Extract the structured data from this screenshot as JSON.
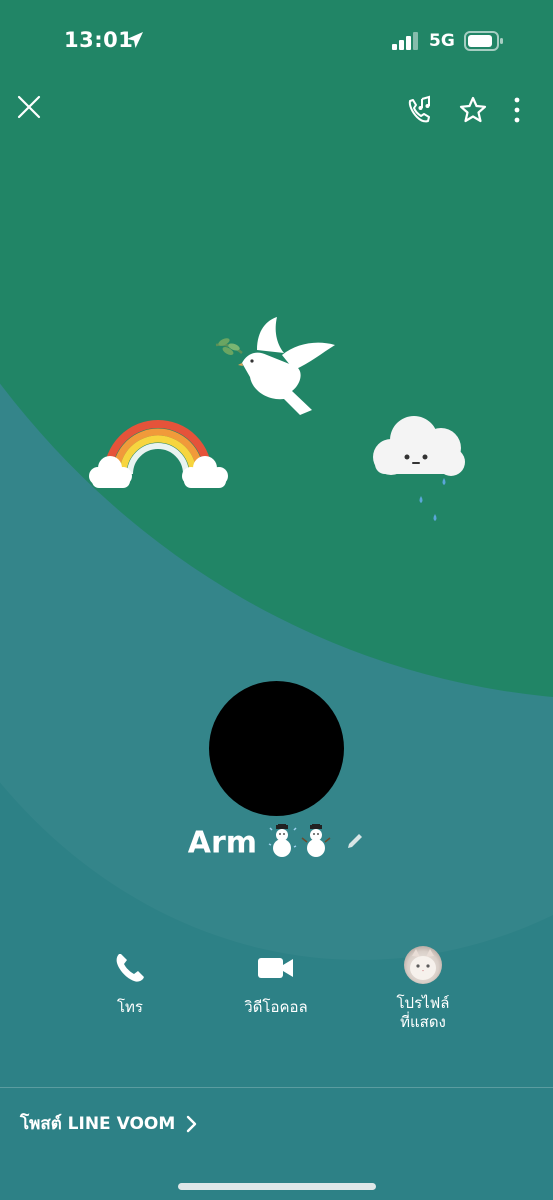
{
  "status_bar": {
    "time": "13:01",
    "network": "5G",
    "icons": [
      "location-arrow-icon",
      "signal-bars-icon",
      "battery-icon"
    ]
  },
  "header": {
    "icons": [
      "close-icon",
      "call-music-icon",
      "star-icon",
      "more-vertical-icon"
    ]
  },
  "decorations": [
    "dove",
    "rainbow",
    "rain-cloud"
  ],
  "profile": {
    "name": "Arm",
    "name_emojis": "☃️☃️",
    "edit_icon": "pencil-icon"
  },
  "actions": [
    {
      "label": "โทร",
      "icon": "phone-icon"
    },
    {
      "label": "วิดีโอคอล",
      "icon": "video-camera-icon"
    },
    {
      "label_line1": "โปรไฟล์",
      "label_line2": "ที่แสดง",
      "icon": "cat-avatar-icon"
    }
  ],
  "voom": {
    "label": "โพสต์ LINE VOOM",
    "icon": "chevron-right-icon"
  },
  "colors": {
    "top_green": "#218566",
    "background_teal": "#2d8186",
    "text": "#ffffff"
  }
}
